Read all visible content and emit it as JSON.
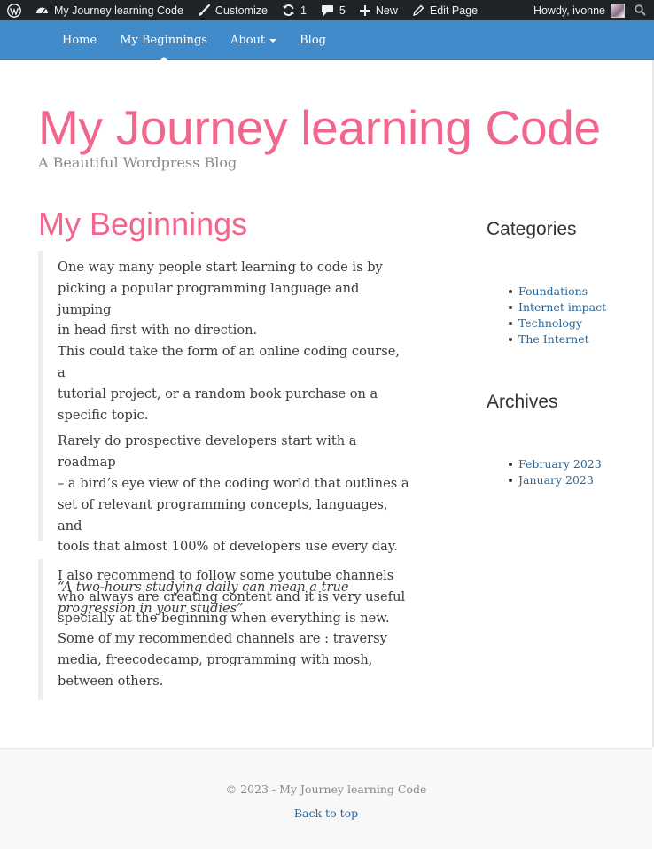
{
  "admin_bar": {
    "site_name": "My Journey learning Code",
    "customize": "Customize",
    "updates_count": "1",
    "comments_count": "5",
    "new_label": "New",
    "edit_label": "Edit Page",
    "howdy": "Howdy, ivonne"
  },
  "nav": {
    "items": [
      {
        "label": "Home"
      },
      {
        "label": "My Beginnings"
      },
      {
        "label": "About"
      },
      {
        "label": "Blog"
      }
    ]
  },
  "header": {
    "title": "My Journey learning Code",
    "tagline": "A Beautiful Wordpress Blog"
  },
  "main": {
    "page_title": "My Beginnings",
    "quote1": {
      "p1_line1": "One way many people start learning to code is by",
      "p1_line2": "picking a popular programming language and jumping",
      "p1_line3": "in head first with no direction.",
      "p1_line4": "This could take the form of an online coding course, a",
      "p1_line5": "tutorial project, or a random book purchase on a",
      "p1_line6": "specific topic.",
      "p2_line1": "Rarely do prospective developers start with a roadmap",
      "p2_line2": "– a bird’s eye view of the coding world that outlines a",
      "p2_line3": "set of relevant programming concepts, languages, and",
      "p2_line4": "tools that almost 100% of developers use every day.",
      "p3_line1": "“A two-hours studying daily can mean a true",
      "p3_line2": "progression in your studies”"
    },
    "quote2": {
      "line1": "I also recommend to follow some youtube channels",
      "line2": "who always are creating content and it is very useful",
      "line3": "specially at the beginning when everything is new.",
      "line4": "Some of my recommended channels are : traversy",
      "line5": "media, freecodecamp, programming with mosh,",
      "line6": "between others."
    }
  },
  "sidebar": {
    "categories_title": "Categories",
    "categories": [
      "Foundations",
      "Internet impact",
      "Technology",
      "The Internet"
    ],
    "archives_title": "Archives",
    "archives": [
      "February 2023",
      "January 2023"
    ]
  },
  "footer": {
    "copyright": "© 2023 - My Journey learning Code",
    "back_to_top": "Back to top"
  },
  "colors": {
    "accent_pink": "#f0668c",
    "nav_blue": "#428bca",
    "link_blue": "#2a6496",
    "admin_bar": "#1d2327"
  }
}
